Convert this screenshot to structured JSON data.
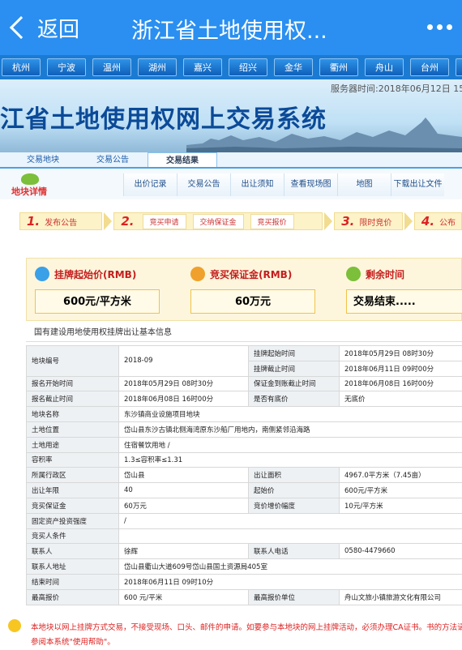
{
  "nav": {
    "back_label": "返回",
    "title": "浙江省土地使用权..."
  },
  "cities": [
    "杭州",
    "宁波",
    "温州",
    "湖州",
    "嘉兴",
    "绍兴",
    "金华",
    "衢州",
    "舟山",
    "台州",
    "丽水"
  ],
  "banner": {
    "server_time": "服务器时间:2018年06月12日 15",
    "system_title": "江省土地使用权网上交易系统"
  },
  "tabs": [
    {
      "label": "交易地块"
    },
    {
      "label": "交易公告"
    },
    {
      "label": "交易结果"
    }
  ],
  "subnav": {
    "logo_text": "地块详情",
    "links": [
      "出价记录",
      "交易公告",
      "出让须知",
      "查看现场图",
      "地图",
      "下载出让文件"
    ]
  },
  "steps": [
    {
      "num": "1.",
      "label": "发布公告"
    },
    {
      "num": "2.",
      "subs": [
        "竞买申请",
        "交纳保证金",
        "竞买报价"
      ]
    },
    {
      "num": "3.",
      "label": "限时竞价"
    },
    {
      "num": "4.",
      "label": "公布"
    }
  ],
  "cards": [
    {
      "title": "挂牌起始价(RMB)",
      "value": "600元/平方米",
      "icon": "coin-icon",
      "color": "#3aa0e8"
    },
    {
      "title": "竞买保证金(RMB)",
      "value": "60万元",
      "icon": "medal-icon",
      "color": "#f0a02c"
    },
    {
      "title": "剩余时间",
      "value": "交易结束.....",
      "icon": "clock-icon",
      "color": "#7bbf3a"
    }
  ],
  "panel_title": "国有建设用地使用权挂牌出让基本信息",
  "rows": {
    "r1": {
      "k": "地块编号",
      "v": "2018-09",
      "k2": "挂牌起始时间",
      "v2": "2018年05月29日 08时30分"
    },
    "r1b": {
      "k2": "挂牌截止时间",
      "v2": "2018年06月11日 09时00分"
    },
    "r2": {
      "k": "报名开始时间",
      "v": "2018年05月29日 08时30分",
      "k2": "保证金到账截止时间",
      "v2": "2018年06月08日 16时00分"
    },
    "r3": {
      "k": "报名截止时间",
      "v": "2018年06月08日 16时00分",
      "k2": "是否有底价",
      "v2": "无底价"
    },
    "r4": {
      "k": "地块名称",
      "v": "东沙镇商业设施项目地块"
    },
    "r5": {
      "k": "土地位置",
      "v": "岱山县东沙古镇北侧海湾原东沙船厂用地内，南侧紧邻沿海路"
    },
    "r6": {
      "k": "土地用途",
      "v": "住宿餐饮用地 /"
    },
    "r7": {
      "k": "容积率",
      "v": "1.3≤容积率≤1.31"
    },
    "r8": {
      "k": "所属行政区",
      "v": "岱山县",
      "k2": "出让面积",
      "v2": "4967.0平方米（7.45亩）"
    },
    "r9": {
      "k": "出让年限",
      "v": "40",
      "k2": "起始价",
      "v2": "600元/平方米"
    },
    "r10": {
      "k": "竞买保证金",
      "v": "60万元",
      "k2": "竞价增价幅度",
      "v2": "10元/平方米"
    },
    "r11": {
      "k": "固定资产投资强度",
      "v": "/"
    },
    "r12": {
      "k": "竞买人条件",
      "v": ""
    },
    "r13": {
      "k": "联系人",
      "v": "徐辉",
      "k2": "联系人电话",
      "v2": "0580-4479660"
    },
    "r14": {
      "k": "联系人地址",
      "v": "岱山县衢山大道609号岱山县国土资源局405室"
    },
    "r15": {
      "k": "结束时间",
      "v": "2018年06月11日 09时10分"
    },
    "r16": {
      "k": "最高报价",
      "v": "600 元/平米",
      "k2": "最高报价单位",
      "v2": "舟山文旅小镇旅游文化有限公司"
    }
  },
  "notice": "本地块以网上挂牌方式交易，不接受现场、口头、邮件的申请。如要参与本地块的网上挂牌活动，必须办理CA证书。书的方法请参阅本系统\"使用帮助\"。"
}
